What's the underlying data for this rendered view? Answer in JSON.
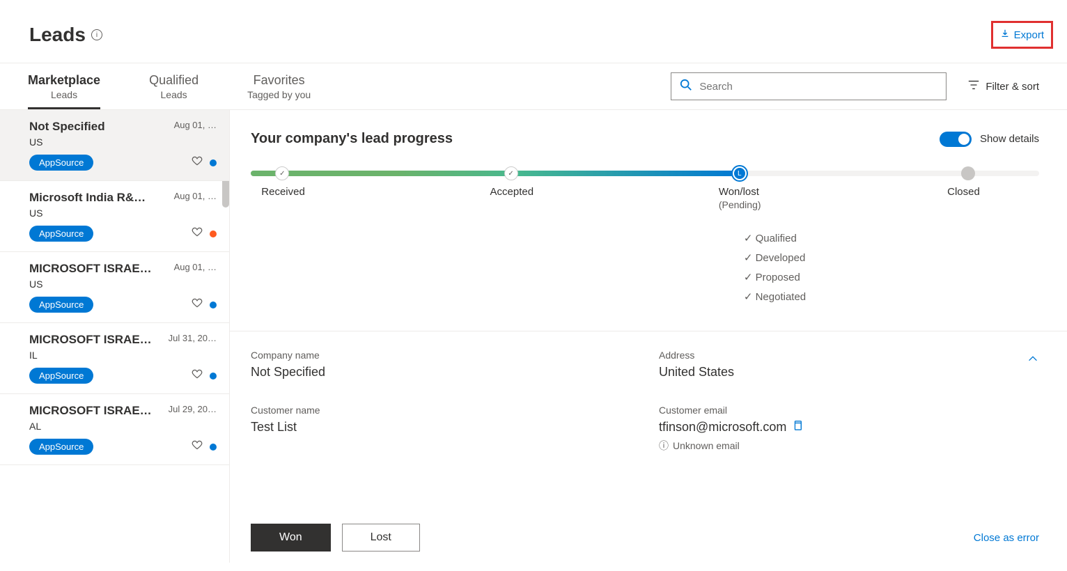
{
  "header": {
    "title": "Leads",
    "export_label": "Export"
  },
  "tabs": [
    {
      "title": "Marketplace",
      "sub": "Leads",
      "active": true
    },
    {
      "title": "Qualified",
      "sub": "Leads",
      "active": false
    },
    {
      "title": "Favorites",
      "sub": "Tagged by you",
      "active": false
    }
  ],
  "search": {
    "placeholder": "Search"
  },
  "filter_sort_label": "Filter & sort",
  "leads": [
    {
      "title": "Not Specified",
      "date": "Aug 01, …",
      "loc": "US",
      "badge": "AppSource",
      "dot": "blue",
      "selected": true
    },
    {
      "title": "Microsoft India R&…",
      "date": "Aug 01, …",
      "loc": "US",
      "badge": "AppSource",
      "dot": "orange",
      "selected": false
    },
    {
      "title": "MICROSOFT ISRAE…",
      "date": "Aug 01, …",
      "loc": "US",
      "badge": "AppSource",
      "dot": "blue",
      "selected": false
    },
    {
      "title": "MICROSOFT ISRAE…",
      "date": "Jul 31, 20…",
      "loc": "IL",
      "badge": "AppSource",
      "dot": "blue",
      "selected": false
    },
    {
      "title": "MICROSOFT ISRAE…",
      "date": "Jul 29, 20…",
      "loc": "AL",
      "badge": "AppSource",
      "dot": "blue",
      "selected": false
    }
  ],
  "progress": {
    "title": "Your company's lead progress",
    "toggle_label": "Show details",
    "stages": [
      {
        "label": "Received",
        "pos": 4,
        "state": "done"
      },
      {
        "label": "Accepted",
        "pos": 33,
        "state": "done"
      },
      {
        "label": "Won/lost",
        "sub": "(Pending)",
        "pos": 62,
        "state": "current"
      },
      {
        "label": "Closed",
        "pos": 91,
        "state": "future"
      }
    ],
    "sub_checks": [
      "Qualified",
      "Developed",
      "Proposed",
      "Negotiated"
    ]
  },
  "details": {
    "company_label": "Company name",
    "company_value": "Not Specified",
    "address_label": "Address",
    "address_value": "United States",
    "customer_label": "Customer name",
    "customer_value": "Test List",
    "email_label": "Customer email",
    "email_value": "tfinson@microsoft.com",
    "email_note": "Unknown email"
  },
  "actions": {
    "won_label": "Won",
    "lost_label": "Lost",
    "close_error_label": "Close as error"
  }
}
